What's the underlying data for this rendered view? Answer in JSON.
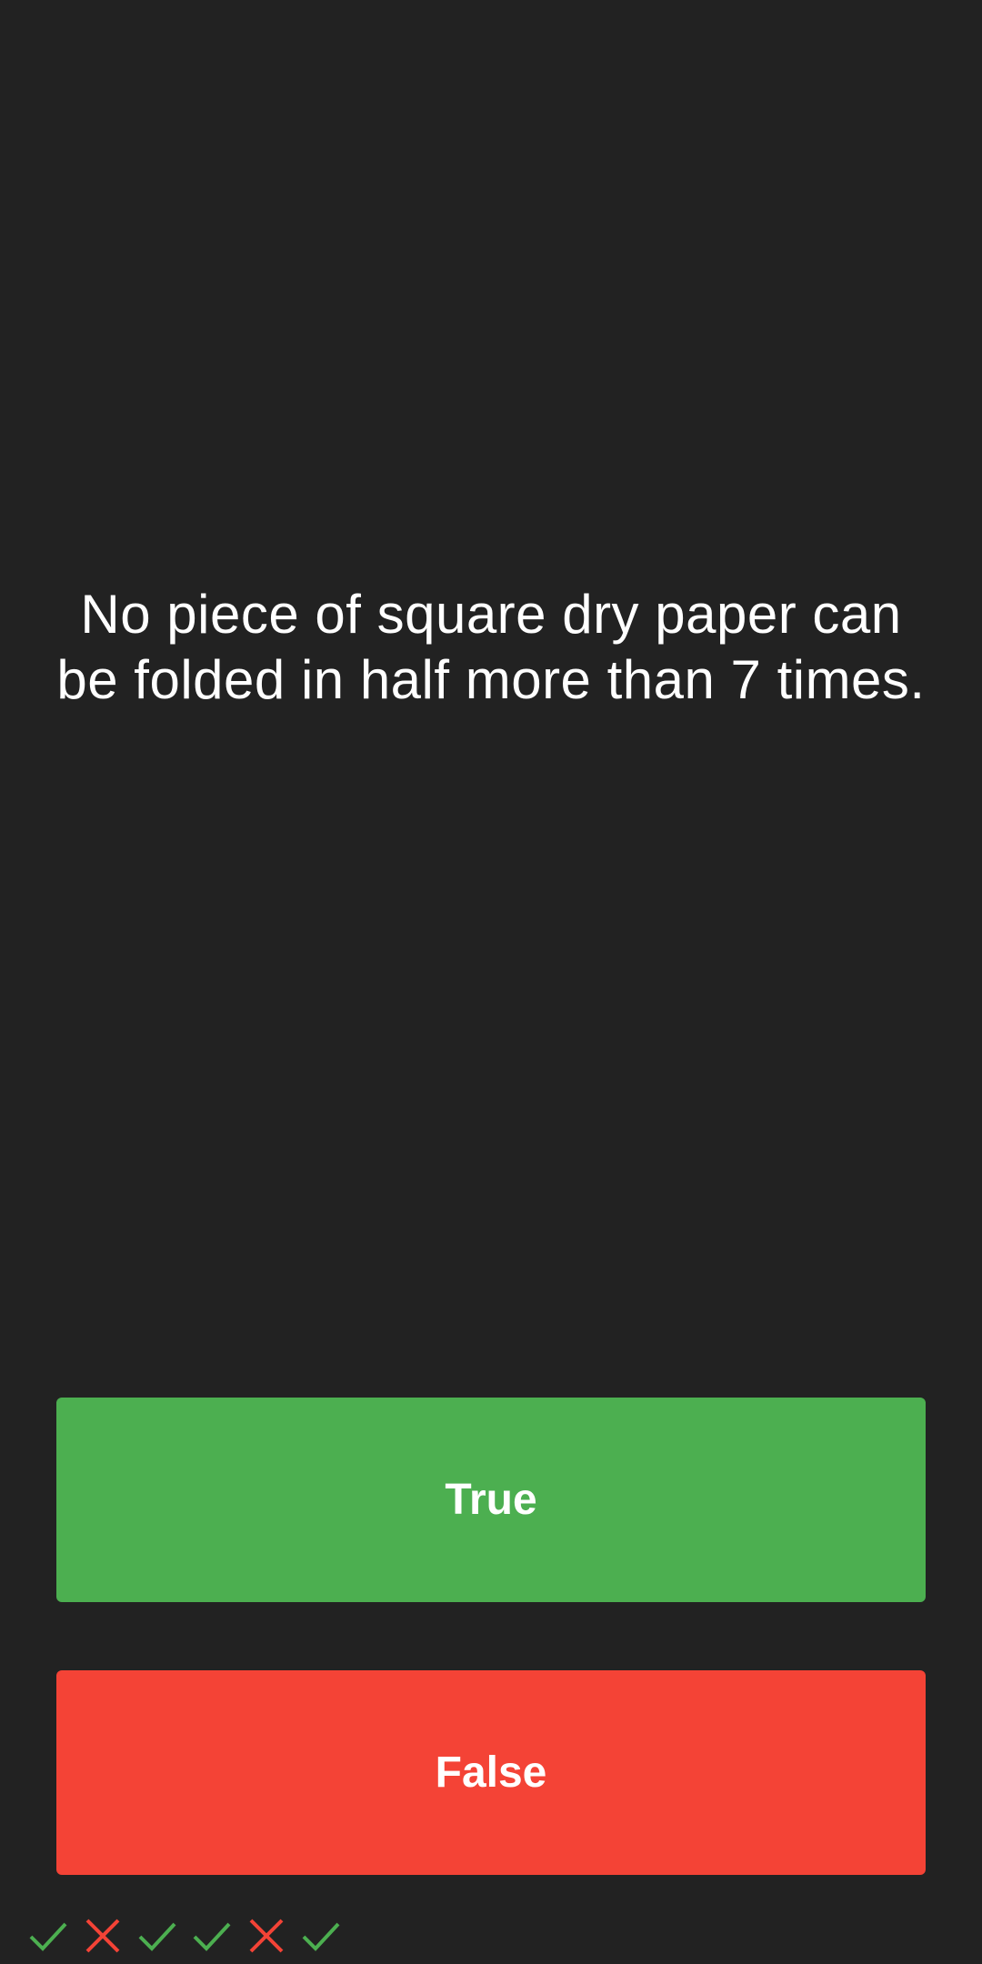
{
  "question": {
    "text": "No piece of square dry paper can be folded in half more than 7 times."
  },
  "answers": {
    "true_label": "True",
    "false_label": "False"
  },
  "colors": {
    "background": "#222222",
    "true_button": "#4CAF50",
    "false_button": "#F44336",
    "correct_mark": "#4CAF50",
    "wrong_mark": "#F44336"
  },
  "history": [
    {
      "result": "correct",
      "icon": "check-icon"
    },
    {
      "result": "wrong",
      "icon": "cross-icon"
    },
    {
      "result": "correct",
      "icon": "check-icon"
    },
    {
      "result": "correct",
      "icon": "check-icon"
    },
    {
      "result": "wrong",
      "icon": "cross-icon"
    },
    {
      "result": "correct",
      "icon": "check-icon"
    }
  ]
}
